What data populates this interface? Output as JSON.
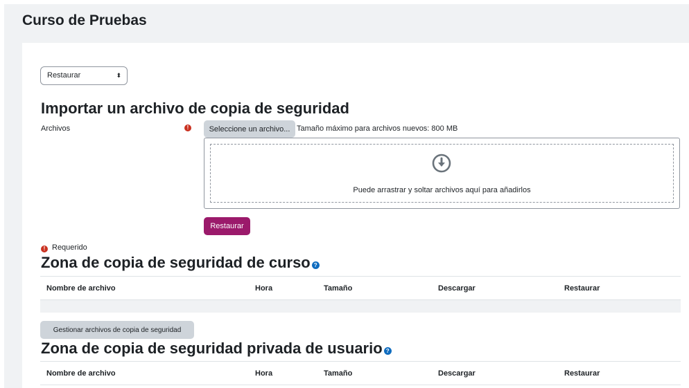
{
  "page": {
    "title": "Curso de Pruebas"
  },
  "mode_select": {
    "value": "Restaurar",
    "caret": "⬍"
  },
  "import": {
    "heading": "Importar un archivo de copia de seguridad",
    "files_label": "Archivos",
    "required_glyph": "!",
    "select_file_button": "Seleccione un archivo...",
    "max_size_text": "Tamaño máximo para archivos nuevos: 800 MB",
    "drop_text": "Puede arrastrar y soltar archivos aquí para añadirlos",
    "restore_button": "Restaurar",
    "required_note": "Requerido"
  },
  "course_zone": {
    "heading": "Zona de copia de seguridad de curso",
    "help_glyph": "?",
    "columns": [
      "Nombre de archivo",
      "Hora",
      "Tamaño",
      "Descargar",
      "Restaurar"
    ],
    "manage_button": "Gestionar archivos de copia de seguridad"
  },
  "user_zone": {
    "heading": "Zona de copia de seguridad privada de usuario",
    "help_glyph": "?",
    "columns": [
      "Nombre de archivo",
      "Hora",
      "Tamaño",
      "Descargar",
      "Restaurar"
    ]
  },
  "colors": {
    "primary_button": "#9b1a6b",
    "secondary_button": "#ced4da",
    "required_icon": "#ca3120",
    "help_icon": "#0f6cbf"
  },
  "icons": {
    "required": "exclamation-circle-icon",
    "help": "question-circle-icon",
    "dropzone": "download-arrow-icon"
  }
}
